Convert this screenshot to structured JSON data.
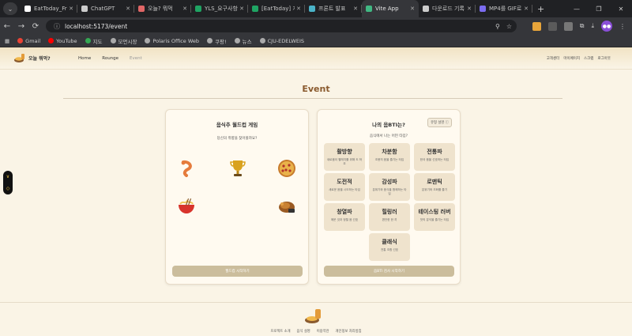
{
  "browser": {
    "tabs": [
      {
        "title": "EatToday_Fr",
        "color": "#ffffff"
      },
      {
        "title": "ChatGPT",
        "color": "#cccccc"
      },
      {
        "title": "오늘? 뭐먹",
        "color": "#e06666"
      },
      {
        "title": "YLS_요구사항",
        "color": "#1fa463"
      },
      {
        "title": "[EatToday] 개",
        "color": "#1fa463"
      },
      {
        "title": "프론트 발표",
        "color": "#4ab3c8"
      },
      {
        "title": "Vite App",
        "color": "#41b883"
      },
      {
        "title": "다운로드 기록",
        "color": "#cccccc"
      },
      {
        "title": "MP4를 GIF로",
        "color": "#7b6cf0"
      }
    ],
    "active_tab_index": 6,
    "url": "localhost:5173/event",
    "bookmarks": [
      {
        "label": "Gmail",
        "color": "#ea4335"
      },
      {
        "label": "YouTube",
        "color": "#ff0000"
      },
      {
        "label": "지도",
        "color": "#34a853"
      },
      {
        "label": "모먼시장",
        "color": "#aaaaaa"
      },
      {
        "label": "Polaris Office Web",
        "color": "#aaaaaa"
      },
      {
        "label": "쿠팡!",
        "color": "#aaaaaa"
      },
      {
        "label": "뉴스",
        "color": "#aaaaaa"
      },
      {
        "label": "CJU-EDELWEIS",
        "color": "#aaaaaa"
      }
    ],
    "profile_initials": "●●"
  },
  "site": {
    "logo_text": "오늘 뭐먹?",
    "nav": [
      "Home",
      "Rounge",
      "Event"
    ],
    "active_nav": "Event",
    "right_nav": [
      "고객센터",
      "마이페이지",
      "스크랩",
      "로그아웃"
    ]
  },
  "page": {
    "title": "Event"
  },
  "worldcup": {
    "title": "음식추 월드컵 게임",
    "subtitle": "당신의 취향을 찾아볼까요?",
    "button": "월드컵 시작하기"
  },
  "mbti": {
    "title": "나의 음BTI는?",
    "info_button": "유형 설명 ⓘ",
    "subtitle": "음식에서 나는 어떤 타입?",
    "button": "음BTI 검사 시작하기",
    "types": [
      {
        "name": "활방향",
        "desc": "새로움이 빨래지를 위해 도 하죠"
      },
      {
        "name": "차분함",
        "desc": "조용히 음을 즐기는 타입"
      },
      {
        "name": "전통파",
        "desc": "한국 음을 선호하는 타입"
      },
      {
        "name": "도전적",
        "desc": "새로운 음을 시도하는 타입"
      },
      {
        "name": "감성파",
        "desc": "분위기와 음식을 함께하는 타입"
      },
      {
        "name": "로맨틱",
        "desc": "분위기와 조화를 즐기"
      },
      {
        "name": "창열파",
        "desc": "매운 것과 정렬 음 선호"
      },
      {
        "name": "힐링러",
        "desc": "편안한 한 끼"
      },
      {
        "name": "테이스팅 러버",
        "desc": "맛의 분석을 즐기는 타입"
      },
      {
        "name": "클래식",
        "desc": "전통 조합 선호"
      }
    ]
  },
  "footer": {
    "links": [
      "프로젝트 소개",
      "음식 설명",
      "이용약관",
      "개인정보 처리방침"
    ]
  },
  "side_widget": {
    "icons": [
      "chevron-down-icon",
      "gem-icon"
    ]
  }
}
